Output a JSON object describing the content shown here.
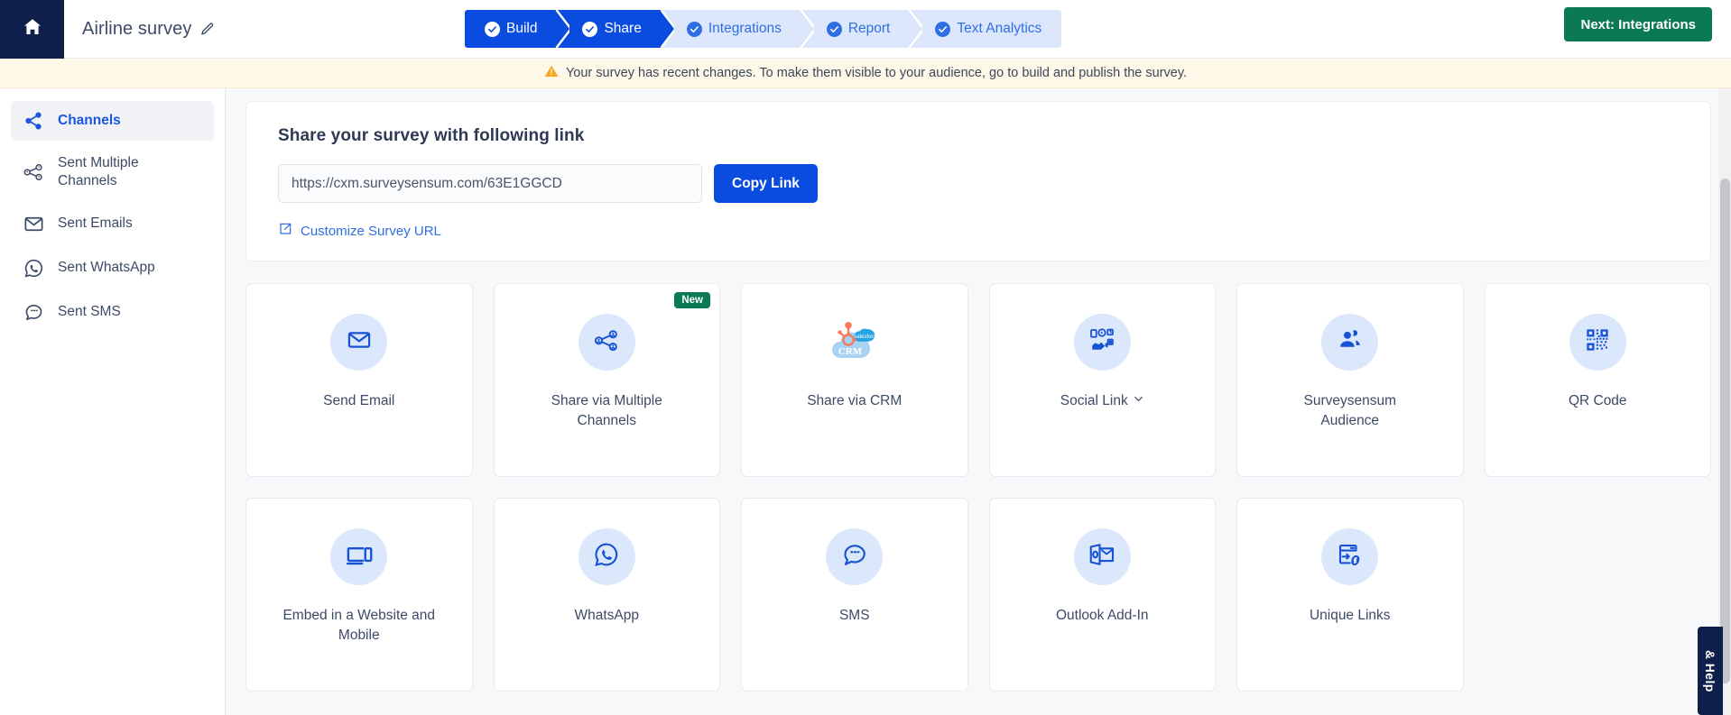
{
  "header": {
    "home_icon": "home-icon",
    "survey_title": "Airline survey",
    "edit_icon": "pencil-icon",
    "next_button": "Next: Integrations",
    "next_button_color": "#0b7a52"
  },
  "stepper": {
    "steps": [
      {
        "label": "Build",
        "state": "active"
      },
      {
        "label": "Share",
        "state": "active"
      },
      {
        "label": "Integrations",
        "state": "inactive"
      },
      {
        "label": "Report",
        "state": "inactive"
      },
      {
        "label": "Text Analytics",
        "state": "inactive"
      }
    ],
    "active_color": "#0b4ce0",
    "inactive_color": "#dce7fb"
  },
  "banner": {
    "icon": "warning-triangle-icon",
    "text": "Your survey has recent changes. To make them visible to your audience, go to build and publish the survey.",
    "background": "#fdf8e7"
  },
  "sidebar": {
    "items": [
      {
        "label": "Channels",
        "icon": "share-nodes-icon",
        "selected": true
      },
      {
        "label": "Sent Multiple Channels",
        "icon": "multi-channel-icon",
        "selected": false
      },
      {
        "label": "Sent Emails",
        "icon": "envelope-icon",
        "selected": false
      },
      {
        "label": "Sent WhatsApp",
        "icon": "whatsapp-icon",
        "selected": false
      },
      {
        "label": "Sent SMS",
        "icon": "sms-icon",
        "selected": false
      }
    ]
  },
  "share_panel": {
    "title": "Share your survey with following link",
    "url_value": "https://cxm.surveysensum.com/63E1GGCD",
    "url_placeholder": "https://cxm.surveysensum.com/63E1GGCD",
    "copy_button": "Copy Link",
    "customize_link": "Customize Survey URL",
    "customize_icon": "external-edit-icon"
  },
  "cards": [
    {
      "label": "Send Email",
      "icon": "envelope-icon",
      "badge": null
    },
    {
      "label": "Share via Multiple Channels",
      "icon": "multi-channel-icon",
      "badge": "New"
    },
    {
      "label": "Share via CRM",
      "icon": "crm-cloud-icon",
      "badge": null
    },
    {
      "label": "Social Link",
      "icon": "social-share-icon",
      "badge": null,
      "chevron": true
    },
    {
      "label": "Surveysensum Audience",
      "icon": "people-icon",
      "badge": null
    },
    {
      "label": "QR Code",
      "icon": "qr-code-icon",
      "badge": null
    },
    {
      "label": "Embed in a Website and Mobile",
      "icon": "devices-icon",
      "badge": null
    },
    {
      "label": "WhatsApp",
      "icon": "whatsapp-icon",
      "badge": null
    },
    {
      "label": "SMS",
      "icon": "sms-icon",
      "badge": null
    },
    {
      "label": "Outlook Add-In",
      "icon": "outlook-icon",
      "badge": null
    },
    {
      "label": "Unique Links",
      "icon": "unique-link-icon",
      "badge": null
    }
  ],
  "help_tab": {
    "label": "& Help"
  }
}
